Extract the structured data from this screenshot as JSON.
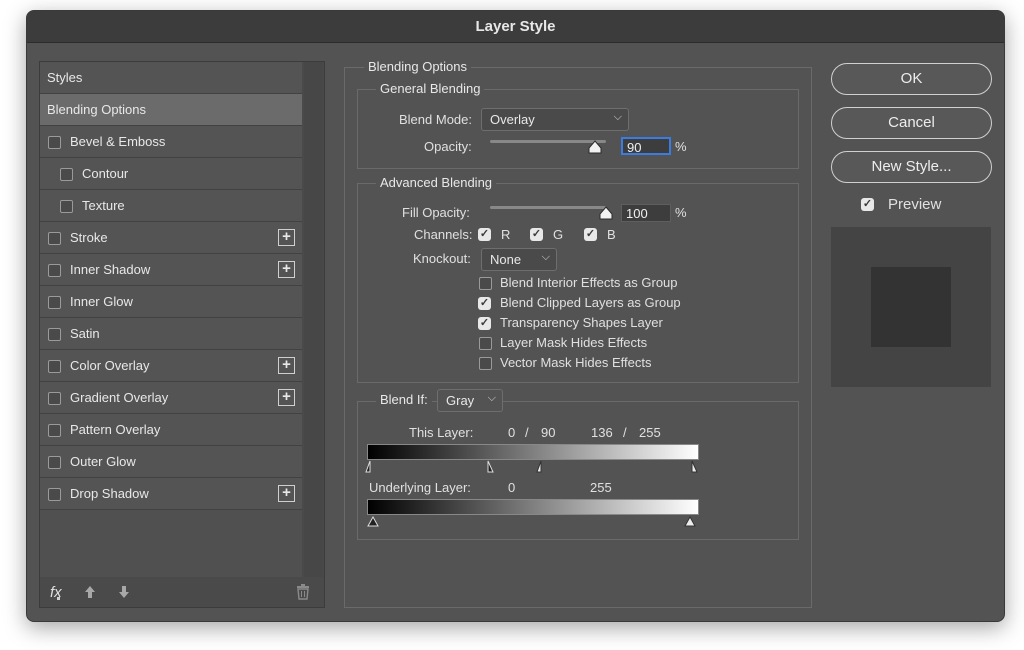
{
  "window": {
    "title": "Layer Style"
  },
  "styles_panel": {
    "header": "Styles",
    "items": [
      {
        "label": "Blending Options"
      },
      {
        "label": "Bevel & Emboss"
      },
      {
        "label": "Contour"
      },
      {
        "label": "Texture"
      },
      {
        "label": "Stroke"
      },
      {
        "label": "Inner Shadow"
      },
      {
        "label": "Inner Glow"
      },
      {
        "label": "Satin"
      },
      {
        "label": "Color Overlay"
      },
      {
        "label": "Gradient Overlay"
      },
      {
        "label": "Pattern Overlay"
      },
      {
        "label": "Outer Glow"
      },
      {
        "label": "Drop Shadow"
      }
    ],
    "fx_label": "fx"
  },
  "blending": {
    "title": "Blending Options",
    "general": {
      "title": "General Blending",
      "blend_mode_label": "Blend Mode:",
      "blend_mode_value": "Overlay",
      "opacity_label": "Opacity:",
      "opacity_value": "90",
      "percent": "%"
    },
    "advanced": {
      "title": "Advanced Blending",
      "fill_opacity_label": "Fill Opacity:",
      "fill_opacity_value": "100",
      "percent": "%",
      "channels_label": "Channels:",
      "channel_r": "R",
      "channel_g": "G",
      "channel_b": "B",
      "knockout_label": "Knockout:",
      "knockout_value": "None",
      "options": [
        {
          "label": "Blend Interior Effects as Group",
          "checked": false
        },
        {
          "label": "Blend Clipped Layers as Group",
          "checked": true
        },
        {
          "label": "Transparency Shapes Layer",
          "checked": true
        },
        {
          "label": "Layer Mask Hides Effects",
          "checked": false
        },
        {
          "label": "Vector Mask Hides Effects",
          "checked": false
        }
      ]
    },
    "blend_if": {
      "label": "Blend If:",
      "value": "Gray",
      "this_layer_label": "This Layer:",
      "this_layer_low_a": "0",
      "this_layer_slash1": "/",
      "this_layer_low_b": "90",
      "this_layer_high_a": "136",
      "this_layer_slash2": "/",
      "this_layer_high_b": "255",
      "underlying_label": "Underlying Layer:",
      "underlying_low": "0",
      "underlying_high": "255"
    }
  },
  "buttons": {
    "ok": "OK",
    "cancel": "Cancel",
    "new_style": "New Style...",
    "preview": "Preview"
  }
}
